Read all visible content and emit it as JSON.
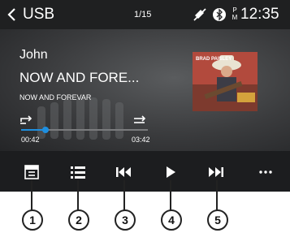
{
  "status_bar": {
    "source": "USB",
    "track_index": "1/15",
    "ampm_top": "P",
    "ampm_bottom": "M",
    "clock": "12:35",
    "icons": [
      "back-arrow-icon",
      "mute-icon",
      "bluetooth-icon"
    ]
  },
  "track": {
    "artist": "John",
    "title": "NOW AND FORE...",
    "album": "NOW AND FOREVAR",
    "cover_text": "BRAD PAISLEY"
  },
  "playback": {
    "elapsed": "00:42",
    "total": "03:42",
    "progress": 0.19
  },
  "controls": {
    "buttons": [
      "eq-icon",
      "playlist-icon",
      "previous-icon",
      "play-icon",
      "next-icon",
      "more-icon"
    ],
    "accent": "#1e8fe0"
  },
  "callouts": [
    "1",
    "2",
    "3",
    "4",
    "5"
  ]
}
